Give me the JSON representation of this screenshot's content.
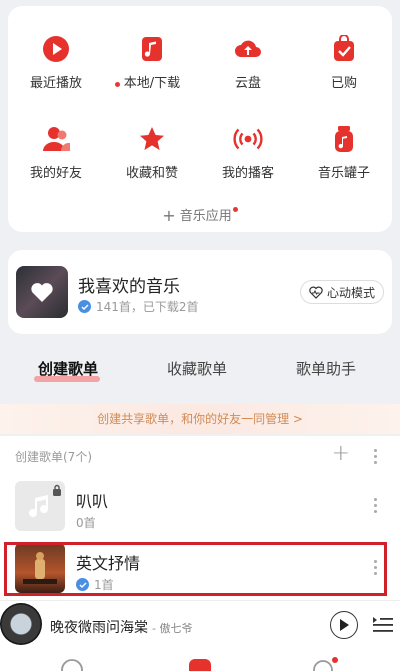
{
  "grid": {
    "items": [
      {
        "label": "最近播放",
        "icon": "play-circle-icon"
      },
      {
        "label": "本地/下载",
        "icon": "music-note-icon"
      },
      {
        "label": "云盘",
        "icon": "cloud-upload-icon"
      },
      {
        "label": "已购",
        "icon": "purchased-bag-icon"
      },
      {
        "label": "我的好友",
        "icon": "friends-icon"
      },
      {
        "label": "收藏和赞",
        "icon": "star-icon"
      },
      {
        "label": "我的播客",
        "icon": "broadcast-icon"
      },
      {
        "label": "音乐罐子",
        "icon": "music-jar-icon"
      }
    ],
    "apps_link": "音乐应用"
  },
  "liked": {
    "title": "我喜欢的音乐",
    "subtitle": "141首，已下载2首",
    "heartbeat_label": "心动模式"
  },
  "tabs": [
    "创建歌单",
    "收藏歌单",
    "歌单助手"
  ],
  "banner": "创建共享歌单，和你的好友一同管理 >",
  "playlists": {
    "header": "创建歌单(7个)",
    "items": [
      {
        "name": "叭叭",
        "count": "0首"
      },
      {
        "name": "英文抒情",
        "count": "1首"
      }
    ]
  },
  "player": {
    "title": "晚夜微雨问海棠",
    "artist": "- 傲七爷"
  },
  "colors": {
    "accent": "#e5322d",
    "highlight_border": "#d0202a",
    "badge_blue": "#4a90e2"
  }
}
